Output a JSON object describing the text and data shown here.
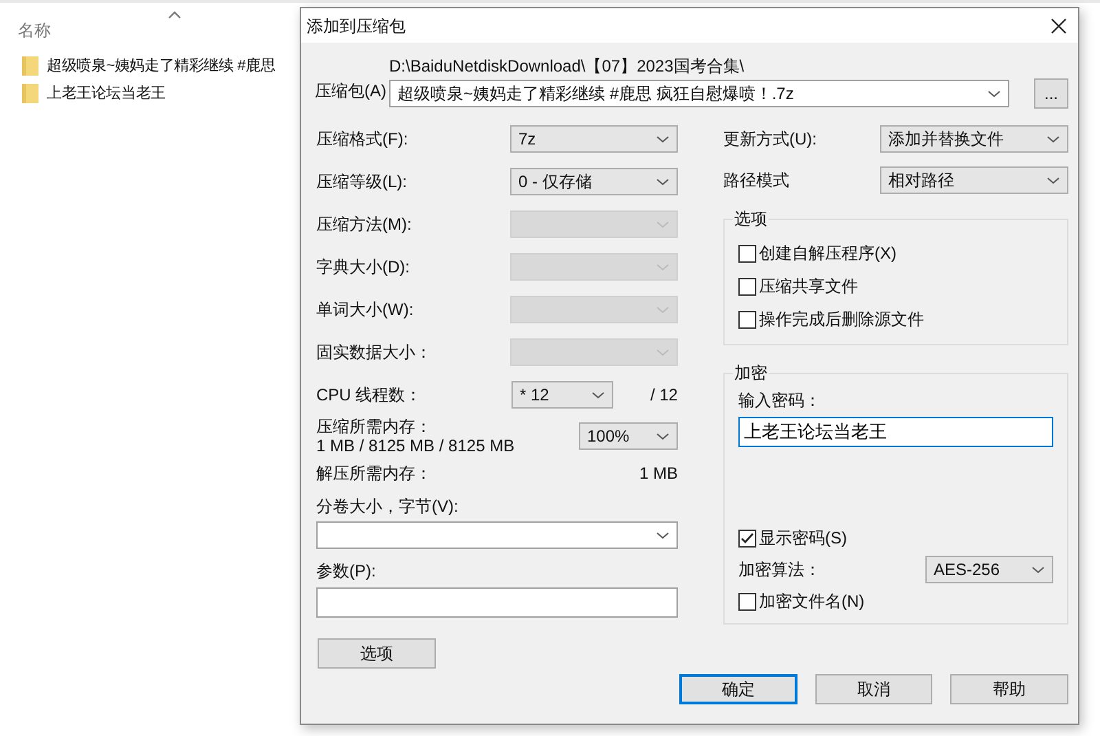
{
  "explorer": {
    "column_header": "名称",
    "files": [
      {
        "name": "超级喷泉~姨妈走了精彩继续 #鹿思"
      },
      {
        "name": "上老王论坛当老王"
      }
    ]
  },
  "dialog": {
    "title": "添加到压缩包",
    "archive": {
      "label": "压缩包(A)",
      "path": "D:\\BaiduNetdiskDownload\\【07】2023国考合集\\",
      "value": "超级喷泉~姨妈走了精彩继续 #鹿思 疯狂自慰爆喷！.7z",
      "browse": "..."
    },
    "settings": [
      {
        "kind": "combo",
        "label": "压缩格式(F):",
        "value": "7z",
        "disabled": false
      },
      {
        "kind": "combo",
        "label": "压缩等级(L):",
        "value": "0 - 仅存储",
        "disabled": false
      },
      {
        "kind": "combo",
        "label": "压缩方法(M):",
        "disabled": true
      },
      {
        "kind": "combo",
        "label": "字典大小(D):",
        "disabled": true
      },
      {
        "kind": "combo",
        "label": "单词大小(W):",
        "disabled": true
      },
      {
        "kind": "combo",
        "label": "固实数据大小：",
        "disabled": true
      },
      {
        "kind": "threads",
        "label": "CPU 线程数：",
        "value": "* 12",
        "total": "/ 12"
      },
      {
        "kind": "memory",
        "label": "压缩所需内存：",
        "detail": "1 MB / 8125 MB / 8125 MB",
        "value": "100%"
      },
      {
        "kind": "info",
        "label": "解压所需内存：",
        "value": "1 MB"
      },
      {
        "kind": "wide_combo",
        "label": "分卷大小，字节(V):"
      },
      {
        "kind": "wide_input",
        "label": "参数(P):"
      }
    ],
    "options_button": "选项",
    "update": {
      "label": "更新方式(U):",
      "value": "添加并替换文件"
    },
    "path_mode": {
      "label": "路径模式",
      "value": "相对路径"
    },
    "options": {
      "legend": "选项",
      "items": [
        {
          "label": "创建自解压程序(X)",
          "checked": false
        },
        {
          "label": "压缩共享文件",
          "checked": false
        },
        {
          "label": "操作完成后删除源文件",
          "checked": false
        }
      ]
    },
    "encryption": {
      "legend": "加密",
      "password_label": "输入密码：",
      "password": "上老王论坛当老王",
      "show_password": {
        "label": "显示密码(S)",
        "checked": true
      },
      "method_label": "加密算法：",
      "method": "AES-256",
      "encrypt_names": {
        "label": "加密文件名(N)",
        "checked": false
      }
    },
    "buttons": [
      {
        "label": "确定",
        "default": true
      },
      {
        "label": "取消",
        "default": false
      },
      {
        "label": "帮助",
        "default": false
      }
    ]
  }
}
